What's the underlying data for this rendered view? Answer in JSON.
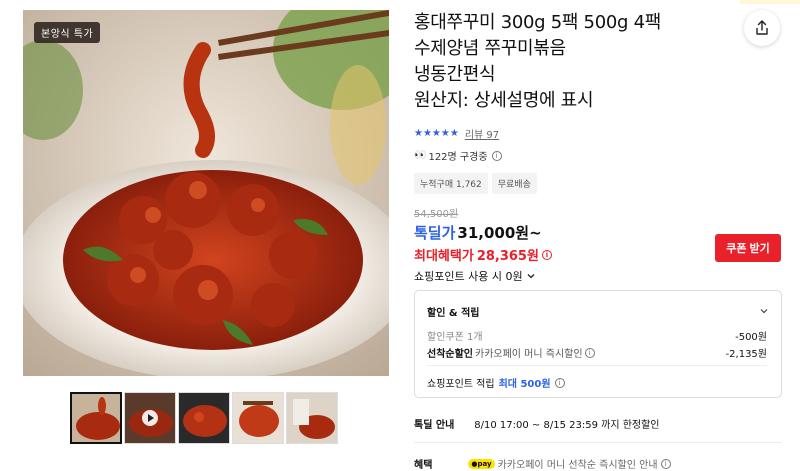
{
  "product": {
    "image_badge": "본앙식 특가",
    "title": "홍대쭈꾸미 300g 5팩 500g 4팩\n수제양념 쭈꾸미볶음\n냉동간편식\n원산지: 상세설명에 표시",
    "rating": {
      "stars": "★★★★★",
      "review_label": "리뷰 97"
    },
    "viewers": {
      "icon": "eyes-icon",
      "text": "122명 구경중"
    },
    "chips": [
      "누적구매 1,762",
      "무료배송"
    ]
  },
  "price": {
    "original": "54,500원",
    "deal_label": "톡딜가",
    "deal_value": "31,000원~",
    "best_label": "최대혜택가",
    "best_value": "28,365원",
    "coupon_button": "쿠폰 받기",
    "point_use": "쇼핑포인트 사용 시 0원"
  },
  "benefits_box": {
    "heading": "할인 & 적립",
    "rows": [
      {
        "label": "할인쿠폰 1개",
        "value": "-500원"
      },
      {
        "label_bold": "선착순할인",
        "label": " 카카오페이 머니 즉시할인",
        "value": "-2,135원"
      }
    ],
    "point_label": "쇼핑포인트 적립",
    "point_value": "최대 500원"
  },
  "deal_info": {
    "label": "톡딜 안내",
    "value": "8/10 17:00 ~ 8/15 23:59 까지 한정할인"
  },
  "benefit": {
    "label": "혜택",
    "pay_badge": "●pay",
    "value": "카카오페이 머니 선착순 즉시할인 안내"
  },
  "colors": {
    "accent_blue": "#2b62e8",
    "accent_red": "#e8212b"
  }
}
